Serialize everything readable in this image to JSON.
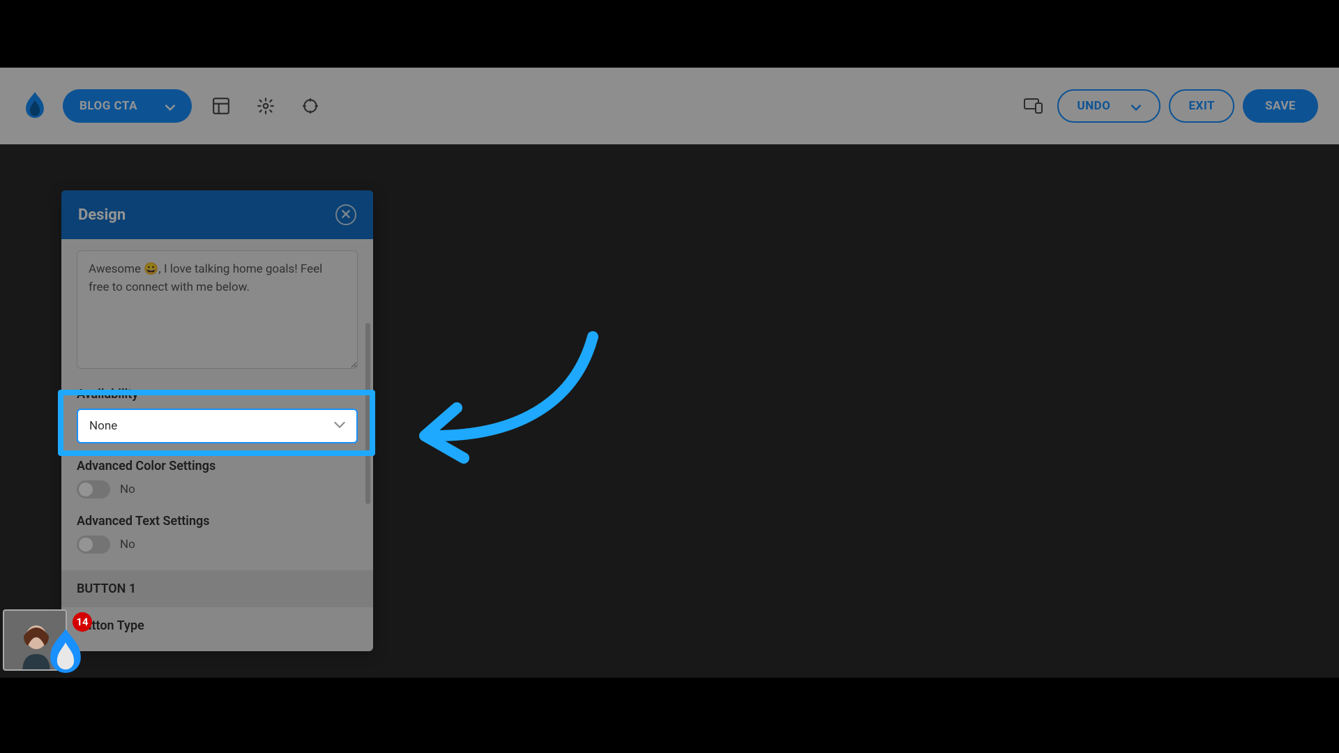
{
  "toolbar": {
    "project_name": "BLOG CTA",
    "undo_label": "UNDO",
    "exit_label": "EXIT",
    "save_label": "SAVE"
  },
  "panel": {
    "title": "Design",
    "textarea_value": "Awesome 😀, I love talking home goals! Feel free to connect with me below.",
    "availability_label": "Availability",
    "availability_value": "None",
    "adv_color_label": "Advanced Color Settings",
    "adv_color_value": "No",
    "adv_text_label": "Advanced Text Settings",
    "adv_text_value": "No",
    "button1_section": "BUTTON 1",
    "button_type_label": "Button Type"
  },
  "notification_count": "14",
  "colors": {
    "accent": "#1890ff",
    "highlight": "#1ea9ff",
    "badge": "#d40000"
  }
}
